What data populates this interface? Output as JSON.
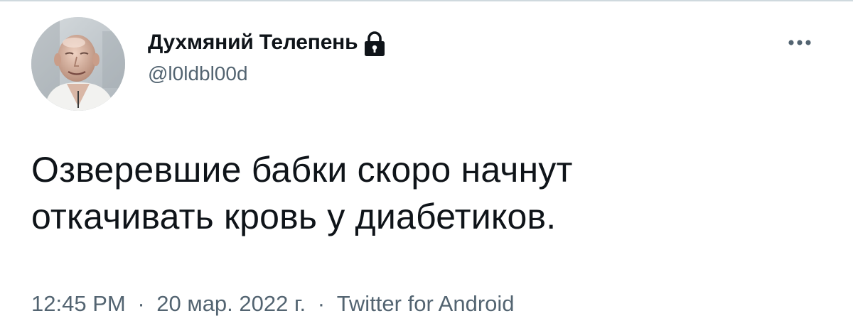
{
  "tweet": {
    "author": {
      "display_name": "Духмяний Телепень",
      "handle": "@l0ldbl00d",
      "protected": true,
      "avatar_icon": "profile-photo"
    },
    "text_lines": [
      "Озверевшие бабки скоро начнут",
      "откачивать кровь у диабетиков."
    ],
    "meta": {
      "time": "12:45 PM",
      "date": "20 мар. 2022 г.",
      "separator": "·",
      "source": "Twitter for Android"
    },
    "menu_icon": "more-horizontal-icon"
  },
  "colors": {
    "text_primary": "#0f1419",
    "text_secondary": "#536471",
    "background": "#ffffff"
  }
}
